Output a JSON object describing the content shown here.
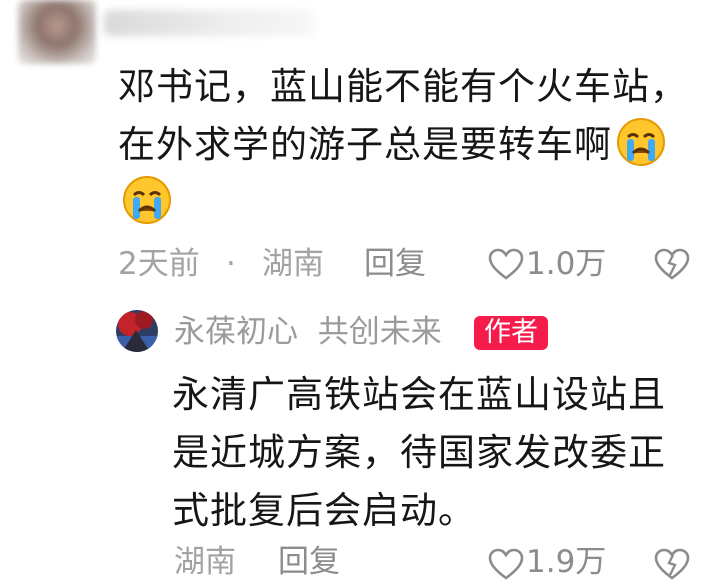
{
  "comment": {
    "text": "邓书记，蓝山能不能有个火车站，在外求学的游子总是要转车啊",
    "time": "2天前",
    "dot": "·",
    "location": "湖南",
    "reply_label": "回复",
    "like_count": "1.0万",
    "emojis": [
      "crying-face-emoji",
      "crying-face-emoji"
    ]
  },
  "reply": {
    "username": "永葆初心  共创未来",
    "author_badge": "作者",
    "text": "永清广高铁站会在蓝山设站且是近城方案，待国家发改委正式批复后会启动。",
    "location": "湖南",
    "reply_label": "回复",
    "like_count": "1.9万"
  },
  "colors": {
    "text": "#161616",
    "meta": "#a3a3a3",
    "badge": "#f51b4b"
  },
  "icons": [
    "heart-outline-icon",
    "dislike-heart-icon"
  ]
}
